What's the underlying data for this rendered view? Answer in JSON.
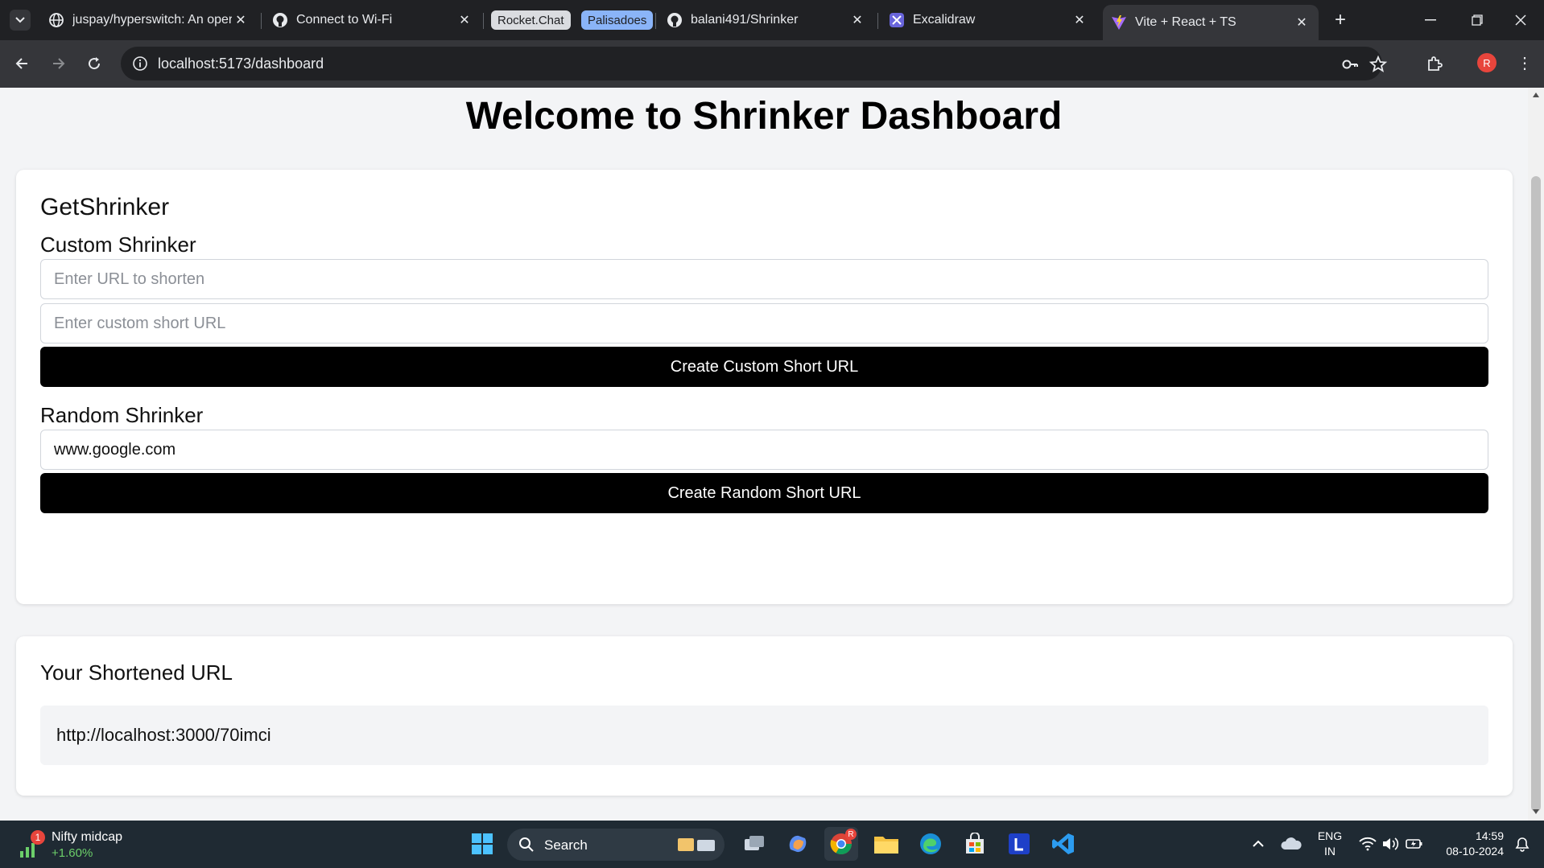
{
  "browser": {
    "tabs": [
      {
        "title": "juspay/hyperswitch: An oper",
        "icon": "globe-icon"
      },
      {
        "title": "Connect to Wi-Fi",
        "icon": "github-icon"
      },
      {
        "title": "balani491/Shrinker",
        "icon": "github-icon"
      },
      {
        "title": "Excalidraw",
        "icon": "excalidraw-icon"
      },
      {
        "title": "Vite + React + TS",
        "icon": "vite-icon",
        "active": true
      }
    ],
    "tab_groups": [
      {
        "label": "Rocket.Chat",
        "color": "#dadce0"
      },
      {
        "label": "Palisadoes",
        "color": "#8ab4f8"
      }
    ],
    "new_tab_label": "+",
    "url": "localhost:5173/dashboard",
    "profile_initial": "R"
  },
  "page": {
    "title": "Welcome to Shrinker Dashboard",
    "section_title": "GetShrinker",
    "custom": {
      "heading": "Custom Shrinker",
      "url_placeholder": "Enter URL to shorten",
      "url_value": "",
      "custom_placeholder": "Enter custom short URL",
      "custom_value": "",
      "button_label": "Create Custom Short URL"
    },
    "random": {
      "heading": "Random Shrinker",
      "url_value": "www.google.com",
      "button_label": "Create Random Short URL"
    },
    "result": {
      "heading": "Your Shortened URL",
      "url": "http://localhost:3000/70imci"
    }
  },
  "taskbar": {
    "widget_title": "Nifty midcap",
    "widget_change": "+1.60%",
    "widget_badge": "1",
    "search_label": "Search",
    "language": "ENG",
    "region": "IN",
    "time": "14:59",
    "date": "08-10-2024",
    "chrome_badge": "R",
    "colors": {
      "accent": "#000000",
      "taskbar": "#1f2a33",
      "positive": "#6ccf6a"
    }
  }
}
